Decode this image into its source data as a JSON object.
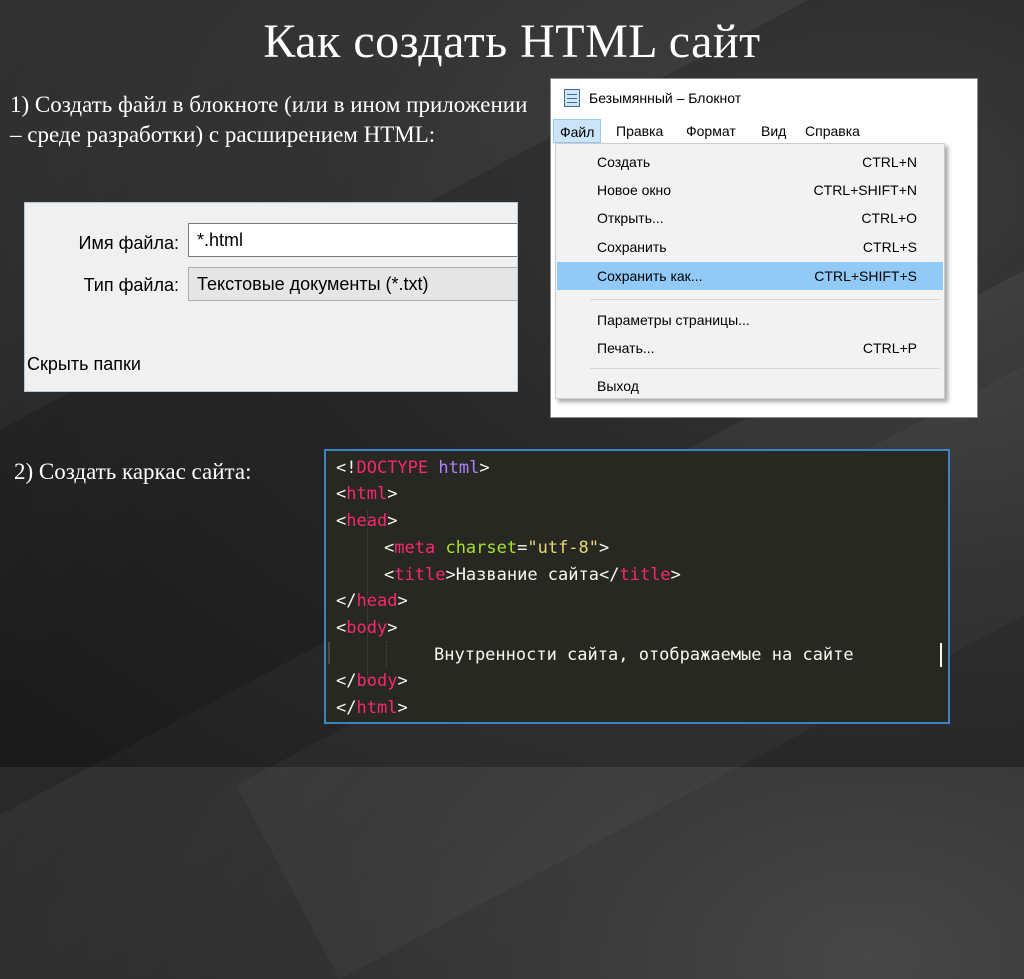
{
  "slide": {
    "title": "Как создать HTML сайт",
    "step1": "1) Создать файл в блокноте (или в ином приложении – среде разработки) с расширением HTML:",
    "step2": "2) Создать каркас сайта:"
  },
  "save_dialog": {
    "filename_label": "Имя файла:",
    "filename_value": "*.html",
    "filetype_label": "Тип файла:",
    "filetype_value": "Текстовые документы (*.txt)",
    "hide_folders": "Скрыть папки"
  },
  "notepad": {
    "title": "Безымянный – Блокнот",
    "menu": {
      "file": "Файл",
      "edit": "Правка",
      "format": "Формат",
      "view": "Вид",
      "help": "Справка"
    },
    "file_menu": [
      {
        "label": "Создать",
        "shortcut": "CTRL+N"
      },
      {
        "label": "Новое окно",
        "shortcut": "CTRL+SHIFT+N"
      },
      {
        "label": "Открыть...",
        "shortcut": "CTRL+O"
      },
      {
        "label": "Сохранить",
        "shortcut": "CTRL+S"
      },
      {
        "label": "Сохранить как...",
        "shortcut": "CTRL+SHIFT+S",
        "highlighted": true
      },
      {
        "label": "Параметры страницы...",
        "shortcut": ""
      },
      {
        "label": "Печать...",
        "shortcut": "CTRL+P"
      },
      {
        "label": "Выход",
        "shortcut": ""
      }
    ]
  },
  "code": {
    "l1": {
      "open": "<!",
      "doctype": "DOCTYPE",
      "sp": " ",
      "html": "html",
      "close": ">"
    },
    "l2": {
      "open": "<",
      "tag": "html",
      "close": ">"
    },
    "l3": {
      "open": "<",
      "tag": "head",
      "close": ">"
    },
    "l4": {
      "open": "<",
      "tag": "meta",
      "sp": " ",
      "attr": "charset",
      "eq": "=",
      "val": "\"utf-8\"",
      "close": ">"
    },
    "l5": {
      "open": "<",
      "tag": "title",
      "close": ">",
      "text": "Название сайта",
      "open2": "</",
      "tag2": "title",
      "close2": ">"
    },
    "l6": {
      "open": "</",
      "tag": "head",
      "close": ">"
    },
    "l7": {
      "open": "<",
      "tag": "body",
      "close": ">"
    },
    "l8": {
      "text": "Внутренности сайта, отображаемые на сайте"
    },
    "l9": {
      "open": "</",
      "tag": "body",
      "close": ">"
    },
    "l10": {
      "open": "</",
      "tag": "html",
      "close": ">"
    }
  },
  "colors": {
    "editor_bg": "#272822",
    "tag": "#f92672",
    "keyword": "#ae81ff",
    "attribute": "#a6e22e",
    "string": "#e6db74",
    "menu_highlight": "#91c9f7"
  }
}
